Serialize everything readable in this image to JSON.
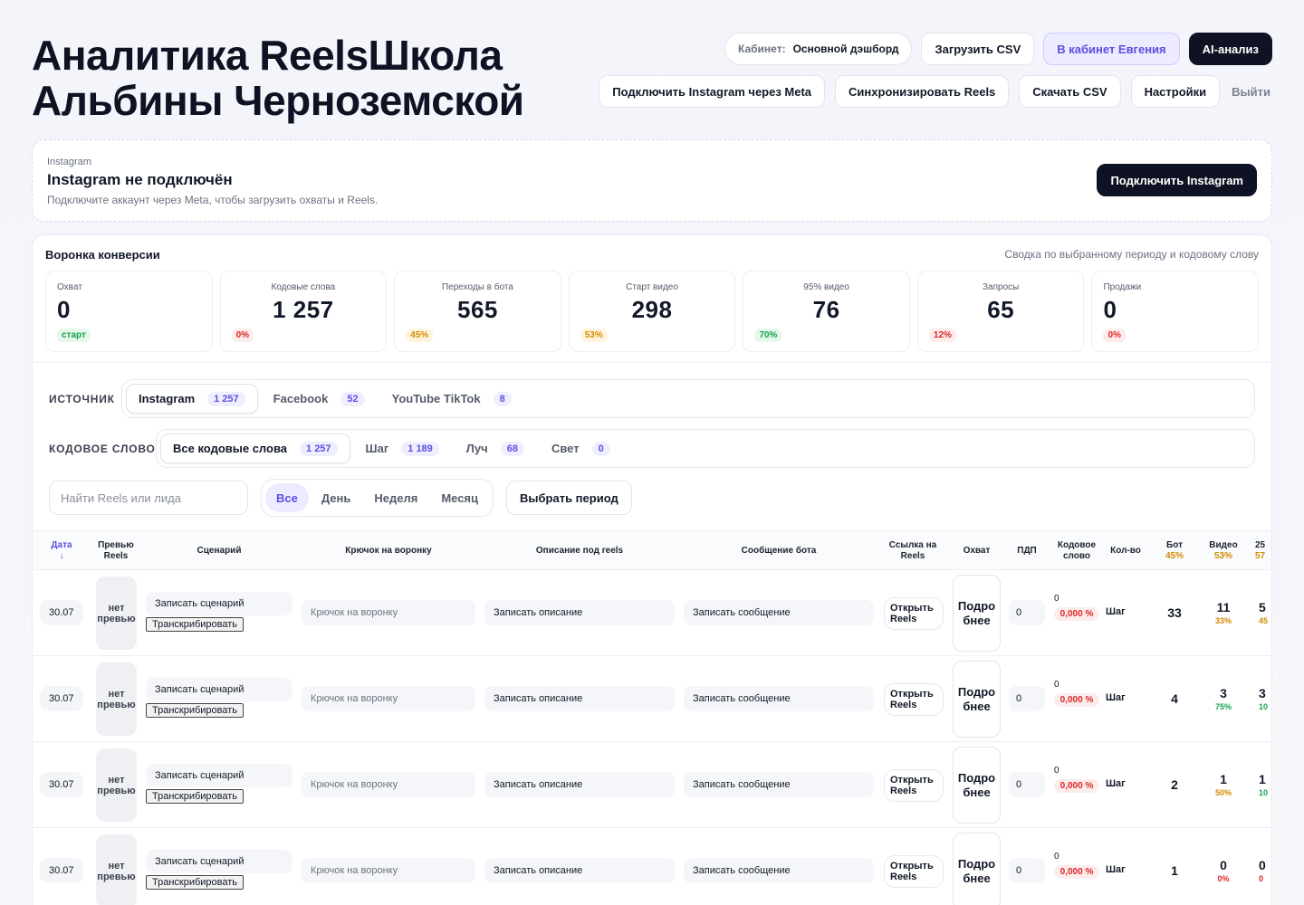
{
  "header": {
    "title_line1": "Аналитика ReelsШкола",
    "title_line2": "Альбины Черноземской",
    "cabinet_label": "Кабинет:",
    "cabinet_value": "Основной дэшборд",
    "upload_csv": "Загрузить CSV",
    "to_cabinet": "В кабинет Евгения",
    "ai": "AI-анализ",
    "connect_meta": "Подключить Instagram через Meta",
    "sync_reels": "Синхронизировать Reels",
    "download_csv": "Скачать CSV",
    "settings": "Настройки",
    "logout": "Выйти"
  },
  "instagram": {
    "small": "Instagram",
    "title": "Instagram не подключён",
    "desc": "Подключите аккаунт через Meta, чтобы загрузить охваты и Reels.",
    "button": "Подключить Instagram"
  },
  "funnel": {
    "title": "Воронка конверсии",
    "subtitle": "Сводка по выбранному периоду и кодовому слову",
    "kpis": [
      {
        "label": "Охват",
        "value": "0",
        "badge": "старт",
        "tone": "green"
      },
      {
        "label": "Кодовые слова",
        "value": "1 257",
        "badge": "0%",
        "tone": "red"
      },
      {
        "label": "Переходы в бота",
        "value": "565",
        "badge": "45%",
        "tone": "amber"
      },
      {
        "label": "Старт видео",
        "value": "298",
        "badge": "53%",
        "tone": "amber"
      },
      {
        "label": "95% видео",
        "value": "76",
        "badge": "70%",
        "tone": "green"
      },
      {
        "label": "Запросы",
        "value": "65",
        "badge": "12%",
        "tone": "red"
      },
      {
        "label": "Продажи",
        "value": "0",
        "badge": "0%",
        "tone": "red"
      }
    ]
  },
  "filters": {
    "source_label": "ИСТОЧНИК",
    "sources": [
      {
        "label": "Instagram",
        "count": "1 257"
      },
      {
        "label": "Facebook",
        "count": "52"
      },
      {
        "label": "YouTube TikTok",
        "count": "8"
      }
    ],
    "keyword_label": "КОДОВОЕ СЛОВО",
    "keywords": [
      {
        "label": "Все кодовые слова",
        "count": "1 257"
      },
      {
        "label": "Шаг",
        "count": "1 189"
      },
      {
        "label": "Луч",
        "count": "68"
      },
      {
        "label": "Свет",
        "count": "0"
      }
    ],
    "search_placeholder": "Найти Reels или лида",
    "periods": [
      "Все",
      "День",
      "Неделя",
      "Месяц"
    ],
    "choose_period": "Выбрать период"
  },
  "table": {
    "headers": {
      "date": "Дата",
      "sort_arrow": "↓",
      "preview": "Превью Reels",
      "scenario": "Сценарий",
      "hook": "Крючок на воронку",
      "desc": "Описание под reels",
      "bot_msg": "Сообщение бота",
      "link": "Ссылка на Reels",
      "reach": "Охват",
      "pdp": "ПДП",
      "kodo": "Кодовое слово",
      "qty": "Кол-во",
      "bot": "Бот",
      "bot_pct": "45%",
      "video": "Видео",
      "video_pct": "53%",
      "next": "25",
      "next_pct": "57"
    },
    "cell_text": {
      "no_preview": "нет превью",
      "scenario": "Записать сценарий",
      "transcribe": "Транскрибировать",
      "hook": "Крючок на воронку",
      "desc": "Записать описание",
      "bot_msg": "Записать сообщение",
      "open": "Открыть Reels",
      "reach": "Подробнее"
    },
    "rows": [
      {
        "date": "30.07",
        "pdp": "0",
        "kodo": "0",
        "kodo_pct": "0,000 %",
        "kw": "Шаг",
        "bot": "33",
        "video": "11",
        "video_pct": "33%",
        "video_tone": "amber",
        "next": "5",
        "next_pct": "45",
        "next_tone": "amber"
      },
      {
        "date": "30.07",
        "pdp": "0",
        "kodo": "0",
        "kodo_pct": "0,000 %",
        "kw": "Шаг",
        "bot": "4",
        "video": "3",
        "video_pct": "75%",
        "video_tone": "green",
        "next": "3",
        "next_pct": "10",
        "next_tone": "green"
      },
      {
        "date": "30.07",
        "pdp": "0",
        "kodo": "0",
        "kodo_pct": "0,000 %",
        "kw": "Шаг",
        "bot": "2",
        "video": "1",
        "video_pct": "50%",
        "video_tone": "amber",
        "next": "1",
        "next_pct": "10",
        "next_tone": "green"
      },
      {
        "date": "30.07",
        "pdp": "0",
        "kodo": "0",
        "kodo_pct": "0,000 %",
        "kw": "Шаг",
        "bot": "1",
        "video": "0",
        "video_pct": "0%",
        "video_tone": "red",
        "next": "0",
        "next_pct": "0",
        "next_tone": "red"
      }
    ]
  },
  "colors": {
    "accent": "#5b4fe0",
    "dark": "#0f1222",
    "green": "#16a34a",
    "red": "#dc2626",
    "amber": "#d48a00"
  }
}
